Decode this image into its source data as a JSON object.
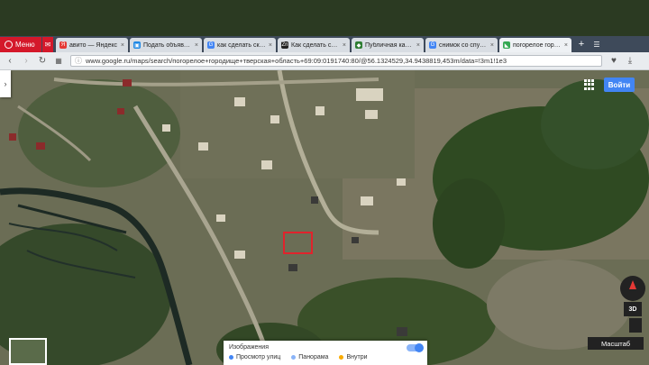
{
  "browser": {
    "menu_label": "Меню",
    "tabs": [
      {
        "label": "авито — Яндекс",
        "icon": "yandex-icon",
        "color": "#e53935",
        "glyph": "Я"
      },
      {
        "label": "Подать объявлени",
        "icon": "avito-icon",
        "color": "#1e88e5",
        "glyph": "▣"
      },
      {
        "label": "как сделать скрин",
        "icon": "google-icon",
        "color": "#4285f4",
        "glyph": "G"
      },
      {
        "label": "Как сделать скрин",
        "icon": "zen-icon",
        "color": "#222222",
        "glyph": "Zn"
      },
      {
        "label": "Публичная кадаст",
        "icon": "cadastre-icon",
        "color": "#2e7d32",
        "glyph": "◆"
      },
      {
        "label": "снимок со спутник",
        "icon": "google-icon",
        "color": "#4285f4",
        "glyph": "G"
      },
      {
        "label": "погорелое городи",
        "icon": "maps-icon",
        "color": "#34a853",
        "glyph": "◣",
        "active": true
      }
    ],
    "url": "www.google.ru/maps/search/погорелое+городище+тверская+область+69:09:0191740:80/@56.1324529,34.9438819,453m/data=!3m1!1e3"
  },
  "map": {
    "signin_label": "Войти",
    "btn3d_label": "3D",
    "scale_label": "Масштаб",
    "layers": {
      "title": "Изображения",
      "items": [
        {
          "label": "Просмотр улиц",
          "color": "#4285f4"
        },
        {
          "label": "Панорама",
          "color": "#8ab4f8"
        },
        {
          "label": "Внутри",
          "color": "#f9ab00"
        }
      ]
    },
    "highlight_color": "#e0232c"
  }
}
